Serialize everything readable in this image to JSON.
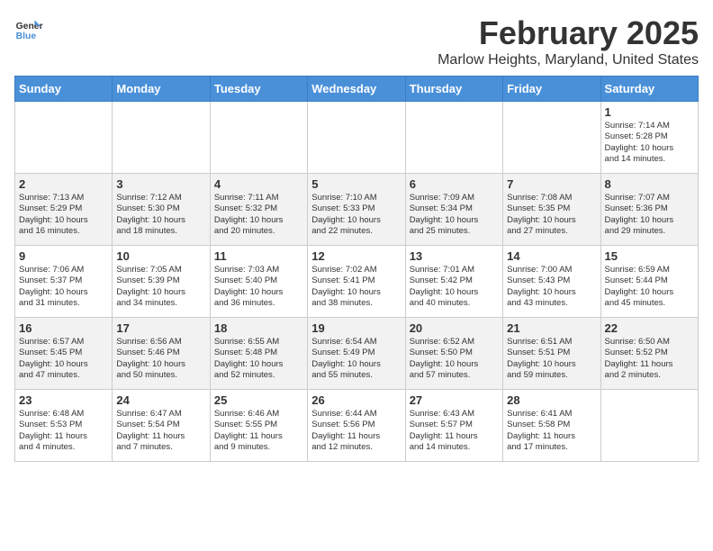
{
  "header": {
    "logo_line1": "General",
    "logo_line2": "Blue",
    "title": "February 2025",
    "subtitle": "Marlow Heights, Maryland, United States"
  },
  "weekdays": [
    "Sunday",
    "Monday",
    "Tuesday",
    "Wednesday",
    "Thursday",
    "Friday",
    "Saturday"
  ],
  "weeks": [
    [
      {
        "day": "",
        "info": ""
      },
      {
        "day": "",
        "info": ""
      },
      {
        "day": "",
        "info": ""
      },
      {
        "day": "",
        "info": ""
      },
      {
        "day": "",
        "info": ""
      },
      {
        "day": "",
        "info": ""
      },
      {
        "day": "1",
        "info": "Sunrise: 7:14 AM\nSunset: 5:28 PM\nDaylight: 10 hours\nand 14 minutes."
      }
    ],
    [
      {
        "day": "2",
        "info": "Sunrise: 7:13 AM\nSunset: 5:29 PM\nDaylight: 10 hours\nand 16 minutes."
      },
      {
        "day": "3",
        "info": "Sunrise: 7:12 AM\nSunset: 5:30 PM\nDaylight: 10 hours\nand 18 minutes."
      },
      {
        "day": "4",
        "info": "Sunrise: 7:11 AM\nSunset: 5:32 PM\nDaylight: 10 hours\nand 20 minutes."
      },
      {
        "day": "5",
        "info": "Sunrise: 7:10 AM\nSunset: 5:33 PM\nDaylight: 10 hours\nand 22 minutes."
      },
      {
        "day": "6",
        "info": "Sunrise: 7:09 AM\nSunset: 5:34 PM\nDaylight: 10 hours\nand 25 minutes."
      },
      {
        "day": "7",
        "info": "Sunrise: 7:08 AM\nSunset: 5:35 PM\nDaylight: 10 hours\nand 27 minutes."
      },
      {
        "day": "8",
        "info": "Sunrise: 7:07 AM\nSunset: 5:36 PM\nDaylight: 10 hours\nand 29 minutes."
      }
    ],
    [
      {
        "day": "9",
        "info": "Sunrise: 7:06 AM\nSunset: 5:37 PM\nDaylight: 10 hours\nand 31 minutes."
      },
      {
        "day": "10",
        "info": "Sunrise: 7:05 AM\nSunset: 5:39 PM\nDaylight: 10 hours\nand 34 minutes."
      },
      {
        "day": "11",
        "info": "Sunrise: 7:03 AM\nSunset: 5:40 PM\nDaylight: 10 hours\nand 36 minutes."
      },
      {
        "day": "12",
        "info": "Sunrise: 7:02 AM\nSunset: 5:41 PM\nDaylight: 10 hours\nand 38 minutes."
      },
      {
        "day": "13",
        "info": "Sunrise: 7:01 AM\nSunset: 5:42 PM\nDaylight: 10 hours\nand 40 minutes."
      },
      {
        "day": "14",
        "info": "Sunrise: 7:00 AM\nSunset: 5:43 PM\nDaylight: 10 hours\nand 43 minutes."
      },
      {
        "day": "15",
        "info": "Sunrise: 6:59 AM\nSunset: 5:44 PM\nDaylight: 10 hours\nand 45 minutes."
      }
    ],
    [
      {
        "day": "16",
        "info": "Sunrise: 6:57 AM\nSunset: 5:45 PM\nDaylight: 10 hours\nand 47 minutes."
      },
      {
        "day": "17",
        "info": "Sunrise: 6:56 AM\nSunset: 5:46 PM\nDaylight: 10 hours\nand 50 minutes."
      },
      {
        "day": "18",
        "info": "Sunrise: 6:55 AM\nSunset: 5:48 PM\nDaylight: 10 hours\nand 52 minutes."
      },
      {
        "day": "19",
        "info": "Sunrise: 6:54 AM\nSunset: 5:49 PM\nDaylight: 10 hours\nand 55 minutes."
      },
      {
        "day": "20",
        "info": "Sunrise: 6:52 AM\nSunset: 5:50 PM\nDaylight: 10 hours\nand 57 minutes."
      },
      {
        "day": "21",
        "info": "Sunrise: 6:51 AM\nSunset: 5:51 PM\nDaylight: 10 hours\nand 59 minutes."
      },
      {
        "day": "22",
        "info": "Sunrise: 6:50 AM\nSunset: 5:52 PM\nDaylight: 11 hours\nand 2 minutes."
      }
    ],
    [
      {
        "day": "23",
        "info": "Sunrise: 6:48 AM\nSunset: 5:53 PM\nDaylight: 11 hours\nand 4 minutes."
      },
      {
        "day": "24",
        "info": "Sunrise: 6:47 AM\nSunset: 5:54 PM\nDaylight: 11 hours\nand 7 minutes."
      },
      {
        "day": "25",
        "info": "Sunrise: 6:46 AM\nSunset: 5:55 PM\nDaylight: 11 hours\nand 9 minutes."
      },
      {
        "day": "26",
        "info": "Sunrise: 6:44 AM\nSunset: 5:56 PM\nDaylight: 11 hours\nand 12 minutes."
      },
      {
        "day": "27",
        "info": "Sunrise: 6:43 AM\nSunset: 5:57 PM\nDaylight: 11 hours\nand 14 minutes."
      },
      {
        "day": "28",
        "info": "Sunrise: 6:41 AM\nSunset: 5:58 PM\nDaylight: 11 hours\nand 17 minutes."
      },
      {
        "day": "",
        "info": ""
      }
    ]
  ]
}
